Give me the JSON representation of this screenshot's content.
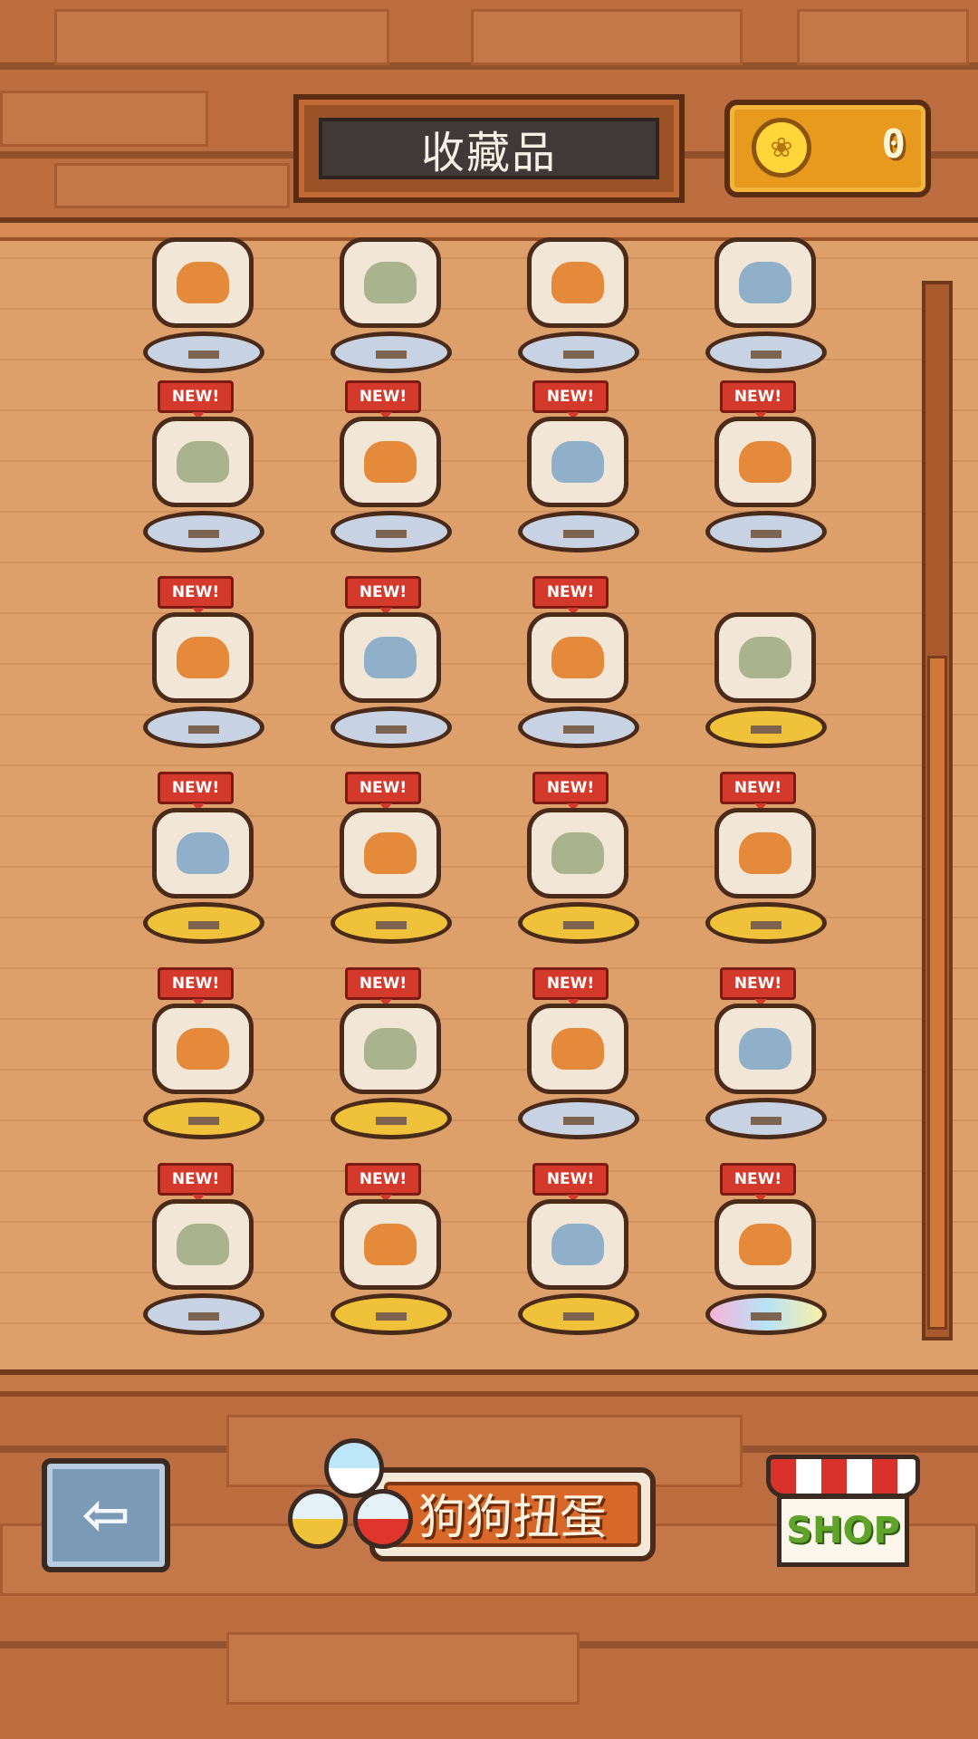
{
  "header": {
    "title": "收藏品",
    "coin_value": "0",
    "coin_icon": "paw-coin-icon"
  },
  "collection": {
    "badge_text": "NEW!",
    "rows": [
      [
        {
          "new": false,
          "ped": "silver"
        },
        {
          "new": false,
          "ped": "silver"
        },
        {
          "new": false,
          "ped": "silver"
        },
        {
          "new": false,
          "ped": "silver"
        }
      ],
      [
        {
          "new": true,
          "ped": "silver"
        },
        {
          "new": true,
          "ped": "silver"
        },
        {
          "new": true,
          "ped": "silver"
        },
        {
          "new": true,
          "ped": "silver"
        }
      ],
      [
        {
          "new": true,
          "ped": "silver"
        },
        {
          "new": true,
          "ped": "silver"
        },
        {
          "new": true,
          "ped": "silver"
        },
        {
          "new": false,
          "ped": "gold"
        }
      ],
      [
        {
          "new": true,
          "ped": "gold"
        },
        {
          "new": true,
          "ped": "gold"
        },
        {
          "new": true,
          "ped": "gold"
        },
        {
          "new": true,
          "ped": "gold"
        }
      ],
      [
        {
          "new": true,
          "ped": "gold"
        },
        {
          "new": true,
          "ped": "gold"
        },
        {
          "new": true,
          "ped": "silver"
        },
        {
          "new": true,
          "ped": "silver"
        }
      ],
      [
        {
          "new": true,
          "ped": "silver"
        },
        {
          "new": true,
          "ped": "gold"
        },
        {
          "new": true,
          "ped": "gold"
        },
        {
          "new": true,
          "ped": "rainbow"
        }
      ]
    ]
  },
  "footer": {
    "back_icon": "arrow-left-icon",
    "gacha_label": "狗狗扭蛋",
    "shop_label": "SHOP"
  },
  "colors": {
    "badge": "#d33a2c",
    "gold_pedestal": "#f0c23a",
    "silver_pedestal": "#c7d3e2"
  }
}
